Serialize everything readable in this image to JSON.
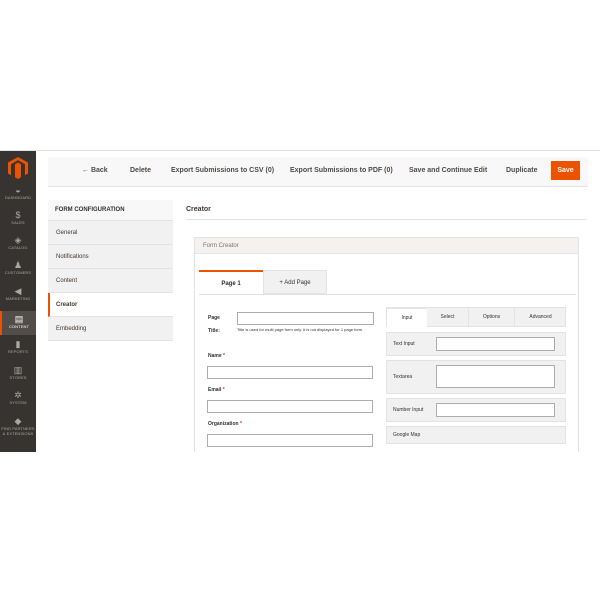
{
  "brand_color": "#eb5202",
  "menu": [
    {
      "icon": "dashboard-icon",
      "glyph": "◒",
      "label": "Dashboard",
      "active": false
    },
    {
      "icon": "sales-icon",
      "glyph": "$",
      "label": "Sales",
      "active": false
    },
    {
      "icon": "catalog-icon",
      "glyph": "◈",
      "label": "Catalog",
      "active": false
    },
    {
      "icon": "customers-icon",
      "glyph": "♟",
      "label": "Customers",
      "active": false
    },
    {
      "icon": "marketing-icon",
      "glyph": "◀",
      "label": "Marketing",
      "active": false
    },
    {
      "icon": "content-icon",
      "glyph": "▤",
      "label": "Content",
      "active": true
    },
    {
      "icon": "reports-icon",
      "glyph": "▮",
      "label": "Reports",
      "active": false
    },
    {
      "icon": "stores-icon",
      "glyph": "▥",
      "label": "Stores",
      "active": false
    },
    {
      "icon": "system-icon",
      "glyph": "✲",
      "label": "System",
      "active": false
    },
    {
      "icon": "partners-icon",
      "glyph": "◆",
      "label": "Find Partners & Extensions",
      "active": false
    }
  ],
  "toolbar": {
    "back": "← Back",
    "delete": "Delete",
    "export_csv": "Export Submissions to CSV (0)",
    "export_pdf": "Export Submissions to PDF (0)",
    "save_continue": "Save and Continue Edit",
    "duplicate": "Duplicate",
    "save": "Save"
  },
  "config": {
    "title": "FORM CONFIGURATION",
    "items": [
      "General",
      "Notifications",
      "Content",
      "Creator",
      "Embedding"
    ],
    "active": "Creator"
  },
  "main": {
    "title": "Creator",
    "panel_title": "Form Creator",
    "page_tabs": [
      "Page 1",
      "+ Add Page"
    ],
    "page_title_label_1": "Page",
    "page_title_label_2": "Title:",
    "page_title_note": "Title is used for multi page form only. It is not displayed for 1 page form.",
    "fields": [
      {
        "label": "Name",
        "required": "*"
      },
      {
        "label": "Email",
        "required": "*"
      },
      {
        "label": "Organization",
        "required": "*"
      }
    ],
    "element_tabs": [
      "Input",
      "Select",
      "Options",
      "Advanced"
    ],
    "elements": [
      "Text Input",
      "Textarea",
      "Number Input",
      "Google Map"
    ]
  }
}
